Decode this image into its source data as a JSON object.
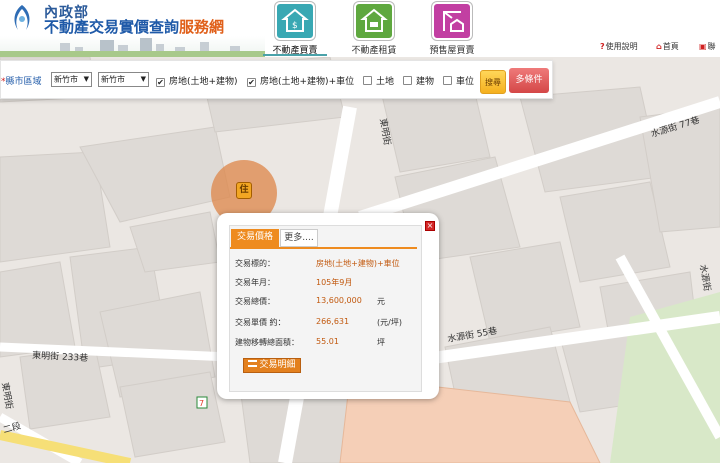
{
  "header": {
    "ministry": "內政部",
    "site_name_main": "不動產交易實價查詢",
    "site_name_accent": "服務網"
  },
  "nav": [
    {
      "label": "不動產買賣",
      "icon": "house-dollar-icon",
      "color": "#39a8b3",
      "active": true
    },
    {
      "label": "不動產租賃",
      "icon": "house-key-icon",
      "color": "#5fa83f",
      "active": false
    },
    {
      "label": "預售屋買賣",
      "icon": "crane-house-icon",
      "color": "#c23fa2",
      "active": false
    }
  ],
  "utility": {
    "help": "使用說明",
    "home": "首頁",
    "contact": "聯"
  },
  "filter": {
    "region_label": "縣市區域",
    "city_select": "新竹市",
    "district_select": "新竹市",
    "types": [
      {
        "label": "房地(土地+建物)",
        "checked": true
      },
      {
        "label": "房地(土地+建物)+車位",
        "checked": true
      },
      {
        "label": "土地",
        "checked": false
      },
      {
        "label": "建物",
        "checked": false
      },
      {
        "label": "車位",
        "checked": false
      }
    ],
    "search_button": "搜尋",
    "multi_button": "多條件"
  },
  "map": {
    "streets": {
      "s1": "東明街",
      "s2": "水源街 77巷",
      "s3": "水源街",
      "s4": "水源街 55巷",
      "s5": "東明街 233巷",
      "s6": "東明街",
      "s7": "二段"
    },
    "marker_label": "住",
    "store_sign": "7"
  },
  "popup": {
    "tab_active": "交易價格",
    "tab_more": "更多....",
    "rows": [
      {
        "label": "交易標的：",
        "value": "房地(土地+建物)+車位",
        "unit": ""
      },
      {
        "label": "交易年月：",
        "value": "105年9月",
        "unit": ""
      },
      {
        "label": "交易總價：",
        "value": "13,600,000",
        "unit": "元"
      },
      {
        "label": "交易單價 約：",
        "value": "266,631",
        "unit": "(元/坪)"
      },
      {
        "label": "建物移轉總面積：",
        "value": "55.01",
        "unit": "坪"
      }
    ],
    "detail_button": "交易明細",
    "close": "×"
  }
}
